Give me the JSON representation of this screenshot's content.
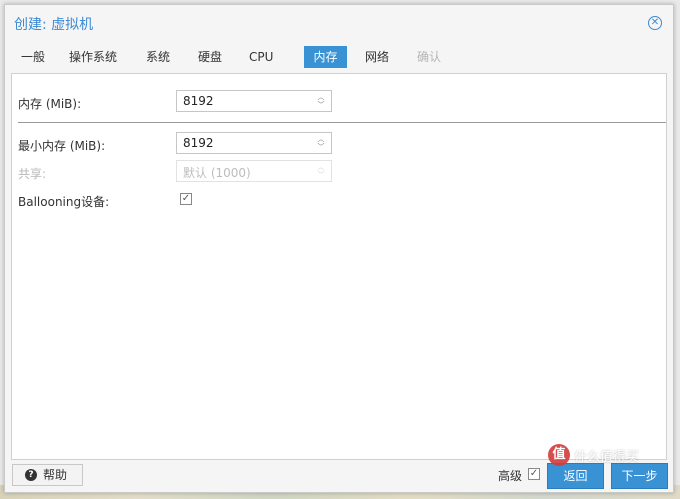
{
  "window": {
    "title": "创建: 虚拟机",
    "close_icon": "close-circle-icon"
  },
  "tabs": [
    {
      "label": "一般",
      "state": "normal"
    },
    {
      "label": "操作系统",
      "state": "normal"
    },
    {
      "label": "系统",
      "state": "normal"
    },
    {
      "label": "硬盘",
      "state": "normal"
    },
    {
      "label": "CPU",
      "state": "normal"
    },
    {
      "label": "内存",
      "state": "active"
    },
    {
      "label": "网络",
      "state": "normal"
    },
    {
      "label": "确认",
      "state": "disabled"
    }
  ],
  "form": {
    "memory": {
      "label": "内存 (MiB):",
      "value": "8192"
    },
    "min_memory": {
      "label": "最小内存 (MiB):",
      "value": "8192"
    },
    "shares": {
      "label": "共享:",
      "placeholder": "默认 (1000)"
    },
    "ballooning": {
      "label": "Ballooning设备:",
      "checked": true
    }
  },
  "footer": {
    "help_label": "帮助",
    "help_icon": "question-circle-icon",
    "advanced_label": "高级",
    "advanced_checked": true,
    "back_label": "返回",
    "next_label": "下一步"
  },
  "watermark": {
    "logo": "值",
    "text": "什么值得买"
  },
  "colors": {
    "accent": "#3892d4",
    "title": "#3d8ad4"
  }
}
